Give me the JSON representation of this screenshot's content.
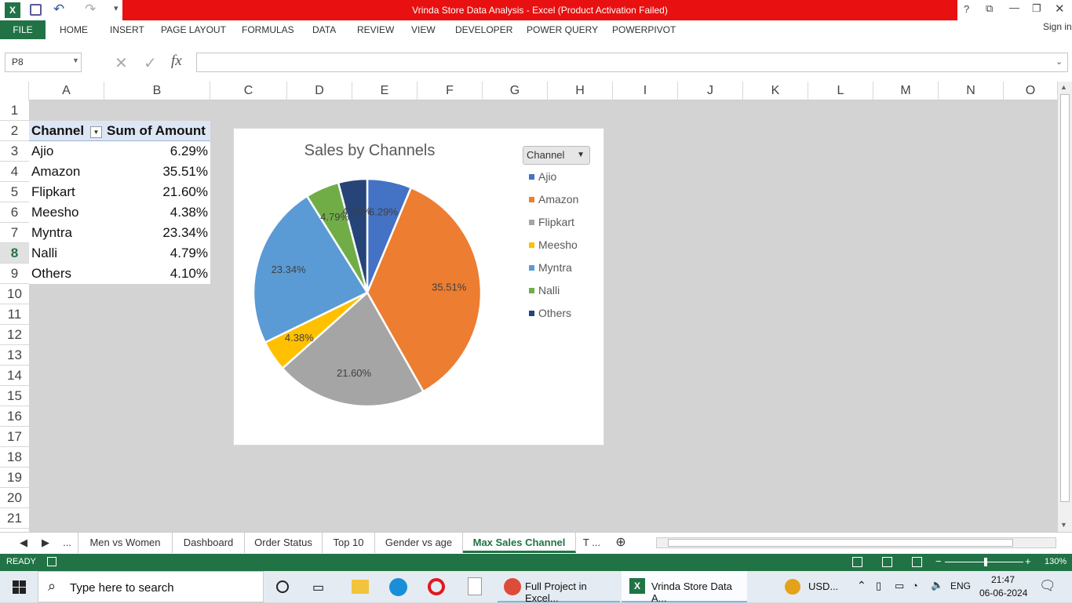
{
  "window": {
    "title": "Vrinda Store Data Analysis -  Excel (Product Activation Failed)",
    "controls": [
      "?",
      "⧉",
      "—",
      "❐",
      "✕"
    ]
  },
  "ribbon": {
    "file": "FILE",
    "tabs": [
      "HOME",
      "INSERT",
      "PAGE LAYOUT",
      "FORMULAS",
      "DATA",
      "REVIEW",
      "VIEW",
      "DEVELOPER",
      "POWER QUERY",
      "POWERPIVOT"
    ],
    "signin": "Sign in"
  },
  "formula": {
    "namebox": "P8",
    "fx": "fx",
    "value": ""
  },
  "columns": [
    "A",
    "B",
    "C",
    "D",
    "E",
    "F",
    "G",
    "H",
    "I",
    "J",
    "K",
    "L",
    "M",
    "N",
    "O"
  ],
  "rows": [
    "1",
    "2",
    "3",
    "4",
    "5",
    "6",
    "7",
    "8",
    "9",
    "10",
    "11",
    "12",
    "13",
    "14",
    "15",
    "16",
    "17",
    "18",
    "19",
    "20",
    "21"
  ],
  "pivot": {
    "header_channel": "Channel",
    "header_amount": "Sum of Amount",
    "rows": [
      {
        "channel": "Ajio",
        "amount": "6.29%"
      },
      {
        "channel": "Amazon",
        "amount": "35.51%"
      },
      {
        "channel": "Flipkart",
        "amount": "21.60%"
      },
      {
        "channel": "Meesho",
        "amount": "4.38%"
      },
      {
        "channel": "Myntra",
        "amount": "23.34%"
      },
      {
        "channel": "Nalli",
        "amount": "4.79%"
      },
      {
        "channel": "Others",
        "amount": "4.10%"
      }
    ]
  },
  "chart_data": {
    "type": "pie",
    "title": "Sales by Channels",
    "legend_filter": "Channel",
    "legend_position": "right",
    "categories": [
      "Ajio",
      "Amazon",
      "Flipkart",
      "Meesho",
      "Myntra",
      "Nalli",
      "Others"
    ],
    "values": [
      6.29,
      35.51,
      21.6,
      4.38,
      23.34,
      4.79,
      4.1
    ],
    "labels": [
      "6.29%",
      "35.51%",
      "21.60%",
      "4.38%",
      "23.34%",
      "4.79%",
      "4.10%"
    ],
    "colors": [
      "#4472c4",
      "#ed7d31",
      "#a5a5a5",
      "#ffc000",
      "#5b9bd5",
      "#70ad47",
      "#264478"
    ]
  },
  "sheets": {
    "nav": [
      "◀",
      "▶",
      "..."
    ],
    "tabs": [
      "Men vs Women",
      "Dashboard",
      "Order Status",
      "Top 10",
      "Gender vs age",
      "Max Sales Channel",
      "T ..."
    ],
    "active": "Max Sales Channel"
  },
  "status": {
    "ready": "READY",
    "zoom": "130%"
  },
  "taskbar": {
    "search": "Type here to search",
    "app1": "Full Project in Excel...",
    "app2": "Vrinda Store Data A...",
    "tray": "USD...",
    "lang": "ENG",
    "time": "21:47",
    "date": "06-06-2024"
  }
}
